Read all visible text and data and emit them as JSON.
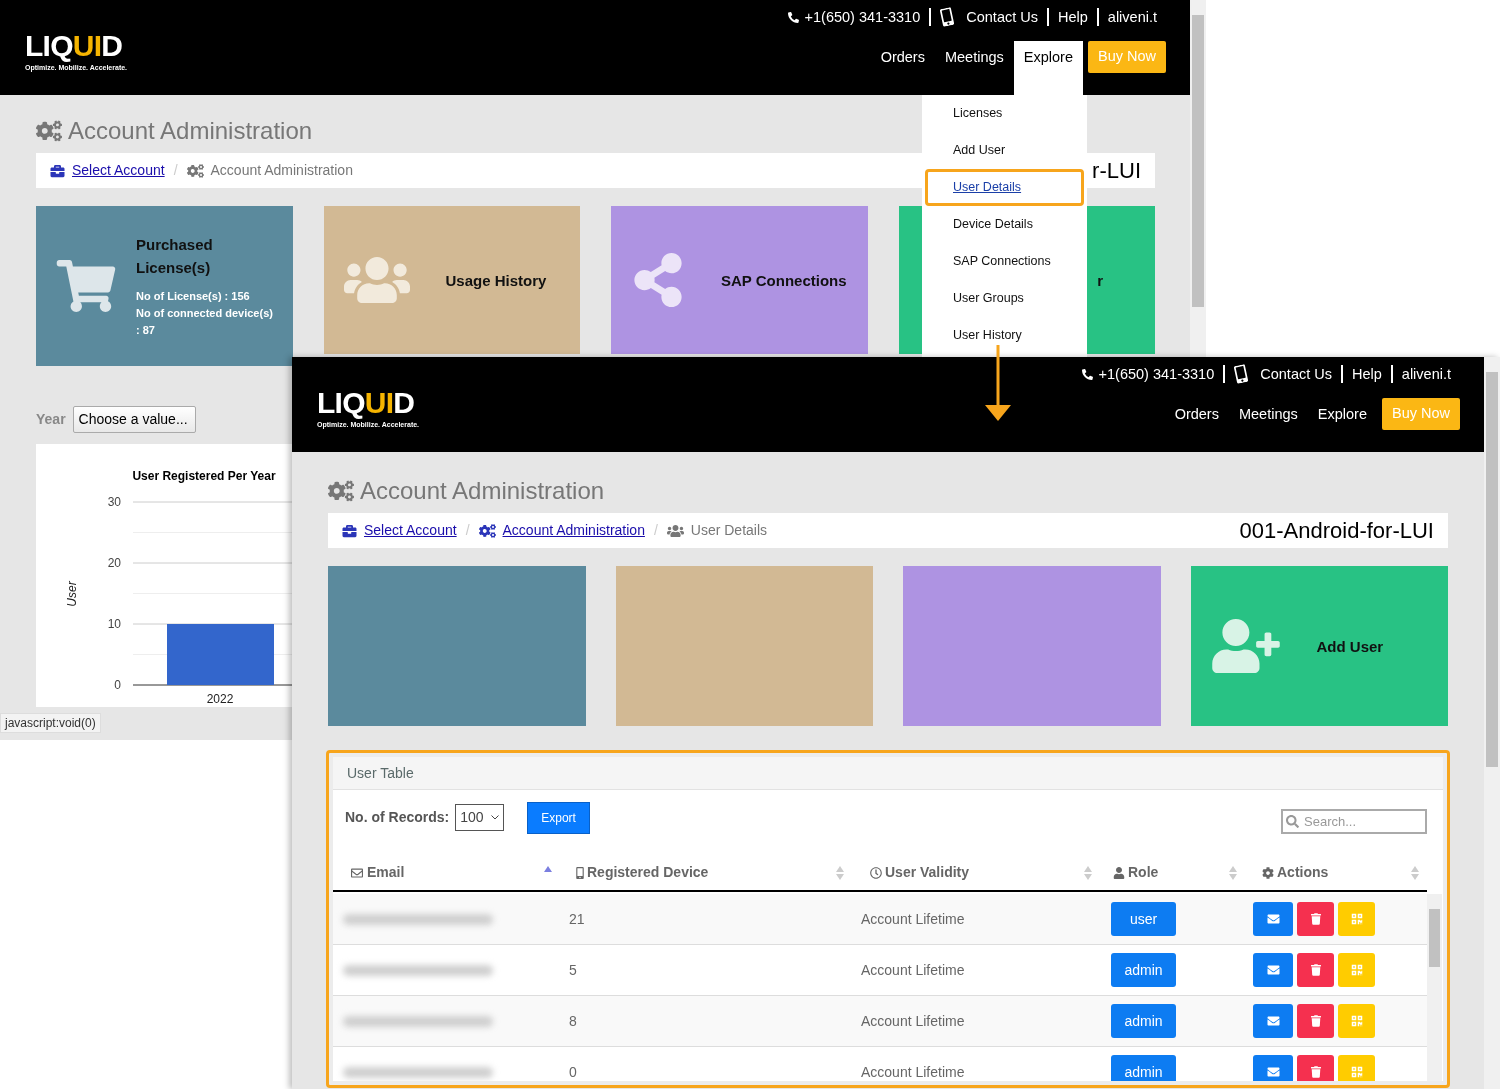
{
  "back_window": {
    "header": {
      "logo": {
        "before": "LIQ",
        "accent": "UI",
        "after": "D",
        "tagline": "Optimize. Mobilize. Accelerate."
      },
      "top_links": [
        {
          "kind": "phone",
          "label": "+1(650) 341-3310"
        },
        {
          "kind": "contact",
          "label": "Contact Us"
        },
        {
          "kind": "plain",
          "label": "Help"
        },
        {
          "kind": "plain",
          "label": "aliveni.t"
        }
      ],
      "nav": [
        {
          "label": "Orders",
          "selected": false
        },
        {
          "label": "Meetings",
          "selected": false
        },
        {
          "label": "Explore",
          "selected": true
        }
      ],
      "buy_button": "Buy Now"
    },
    "page_title": "Account Administration",
    "breadcrumb": [
      {
        "kind": "account",
        "label": "Select Account",
        "link": true
      },
      {
        "kind": "admin",
        "label": "Account Administration",
        "link": false
      }
    ],
    "breadcrumb_separator": "/",
    "account_name": "r-LUI",
    "cards": [
      {
        "kind": "licenses",
        "show_icon": true,
        "title": "Purchased License(s)",
        "lines": [
          "No of License(s) : 156",
          "No of connected device(s) : 87"
        ]
      },
      {
        "kind": "usage",
        "show_icon": true,
        "title": "Usage History"
      },
      {
        "kind": "sap",
        "show_icon": true,
        "title": "SAP Connections"
      },
      {
        "kind": "add-user",
        "show_icon": false,
        "title": "r"
      }
    ],
    "year_filter": {
      "label": "Year",
      "value": "Choose a value..."
    },
    "chart_data": {
      "type": "bar",
      "title": "User Registered Per Year",
      "ylabel": "User",
      "categories": [
        "2022"
      ],
      "values": [
        10
      ],
      "ylim": [
        0,
        30
      ],
      "yticks": [
        0,
        10,
        20,
        30
      ]
    },
    "explore_menu": [
      {
        "label": "Licenses",
        "selected": false
      },
      {
        "label": "Add User",
        "selected": false
      },
      {
        "label": "User Details",
        "selected": true
      },
      {
        "label": "Device Details",
        "selected": false
      },
      {
        "label": "SAP Connections",
        "selected": false
      },
      {
        "label": "User Groups",
        "selected": false
      },
      {
        "label": "User History",
        "selected": false
      }
    ],
    "status_tooltip": "javascript:void(0)"
  },
  "front_window": {
    "header": {
      "logo": {
        "before": "LIQ",
        "accent": "UI",
        "after": "D",
        "tagline": "Optimize. Mobilize. Accelerate."
      },
      "top_links": [
        {
          "kind": "phone",
          "label": "+1(650) 341-3310"
        },
        {
          "kind": "contact",
          "label": "Contact Us"
        },
        {
          "kind": "plain",
          "label": "Help"
        },
        {
          "kind": "plain",
          "label": "aliveni.t"
        }
      ],
      "nav": [
        {
          "label": "Orders",
          "selected": false
        },
        {
          "label": "Meetings",
          "selected": false
        },
        {
          "label": "Explore",
          "selected": false
        }
      ],
      "buy_button": "Buy Now"
    },
    "page_title": "Account Administration",
    "breadcrumb": [
      {
        "kind": "account",
        "label": "Select Account",
        "link": true
      },
      {
        "kind": "admin",
        "label": "Account Administration",
        "link": true
      },
      {
        "kind": "users",
        "label": "User Details",
        "link": false
      }
    ],
    "breadcrumb_separator": "/",
    "account_name": "001-Android-for-LUI",
    "cards": [
      {
        "kind": "licenses",
        "show_icon": false
      },
      {
        "kind": "usage",
        "show_icon": false
      },
      {
        "kind": "sap",
        "show_icon": false
      },
      {
        "kind": "add-user",
        "show_icon": true,
        "title": "Add User"
      }
    ],
    "user_table": {
      "title": "User Table",
      "records_label": "No. of Records:",
      "records_value": "100",
      "export_button": "Export",
      "search": {
        "placeholder": "Search..."
      },
      "columns": [
        {
          "kind": "email",
          "label": "Email",
          "sorted": true
        },
        {
          "kind": "device",
          "label": "Registered Device",
          "sorted": false
        },
        {
          "kind": "validity",
          "label": "User Validity",
          "sorted": false
        },
        {
          "kind": "role",
          "label": "Role",
          "sorted": false
        },
        {
          "kind": "actions",
          "label": "Actions",
          "sorted": false
        }
      ],
      "rows": [
        {
          "device": "21",
          "validity": "Account Lifetime",
          "role": "user"
        },
        {
          "device": "5",
          "validity": "Account Lifetime",
          "role": "admin"
        },
        {
          "device": "8",
          "validity": "Account Lifetime",
          "role": "admin"
        },
        {
          "device": "0",
          "validity": "Account Lifetime",
          "role": "admin"
        }
      ]
    }
  }
}
